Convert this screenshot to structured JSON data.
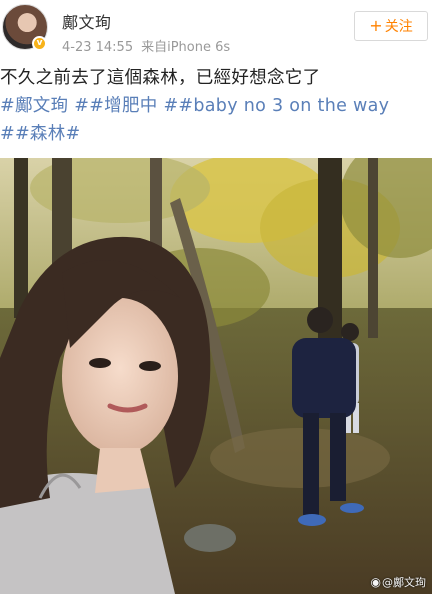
{
  "header": {
    "username": "鄺文珣",
    "date": "4-23 14:55",
    "source": "来自iPhone 6s",
    "follow_label": "关注",
    "follow_icon": "plus-icon",
    "verified_icon": "verified-badge-icon",
    "accent_color": "#ff8200"
  },
  "post": {
    "text_line1": "不久之前去了這個森林，已經好想念它了",
    "hashtag_1": "#鄺文珣",
    "hashtag_2": "##增肥中",
    "hashtag_3": "##baby no 3 on the way",
    "hashtag_4": "##森林#",
    "hashtag_color": "#5a7fb8"
  },
  "photo": {
    "watermark_text": "@鄺文珣",
    "watermark_icon": "weibo-logo-icon"
  }
}
